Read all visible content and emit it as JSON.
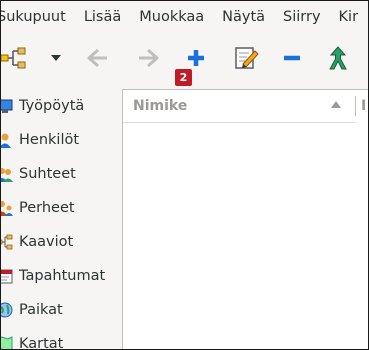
{
  "menubar": {
    "items": [
      "Sukupuut",
      "Lisää",
      "Muokkaa",
      "Näytä",
      "Siirry",
      "Kir"
    ]
  },
  "toolbar": {
    "badge": "2",
    "buttons": [
      {
        "icon": "tree-view-icon",
        "enabled": true
      },
      {
        "icon": "dropdown-arrow-icon",
        "enabled": true
      },
      {
        "icon": "back-arrow-icon",
        "enabled": false
      },
      {
        "icon": "forward-arrow-icon",
        "enabled": false
      },
      {
        "icon": "add-plus-icon",
        "enabled": true
      },
      {
        "icon": "edit-pencil-icon",
        "enabled": true
      },
      {
        "icon": "remove-minus-icon",
        "enabled": true
      },
      {
        "icon": "merge-icon",
        "enabled": true
      }
    ]
  },
  "sidebar": {
    "items": [
      {
        "label": "Työpöytä",
        "icon": "dashboard-icon"
      },
      {
        "label": "Henkilöt",
        "icon": "people-icon"
      },
      {
        "label": "Suhteet",
        "icon": "relationships-icon"
      },
      {
        "label": "Perheet",
        "icon": "families-icon"
      },
      {
        "label": "Kaaviot",
        "icon": "charts-icon"
      },
      {
        "label": "Tapahtumat",
        "icon": "events-icon"
      },
      {
        "label": "Paikat",
        "icon": "places-icon"
      },
      {
        "label": "Kartat",
        "icon": "maps-icon"
      }
    ]
  },
  "list": {
    "column_title": "Nimike",
    "column2_title": "I"
  },
  "colors": {
    "badge": "#c01c28",
    "add": "#1c71d8",
    "merge": "#26a269"
  }
}
